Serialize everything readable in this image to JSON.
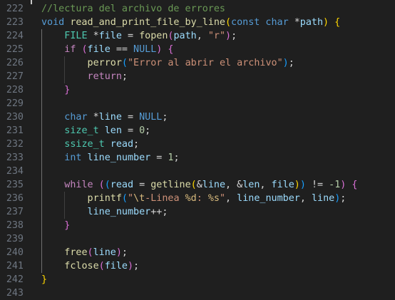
{
  "editor": {
    "language": "c",
    "colors": {
      "background": "#1f1f1f",
      "line_number": "#6e7681",
      "comment": "#6a9955",
      "keyword": "#569cd6",
      "control": "#c586c0",
      "type": "#4ec9b0",
      "function": "#dcdcaa",
      "variable": "#9cdcfe",
      "string": "#ce9178",
      "number": "#b5cea8",
      "bracket_1": "#ffd700",
      "bracket_2": "#da70d6",
      "bracket_3": "#179fff"
    },
    "lines": [
      {
        "num": "222",
        "indent": 0,
        "tokens": [
          {
            "t": "//lectura del archivo de errores",
            "c": "comment"
          }
        ]
      },
      {
        "num": "223",
        "indent": 0,
        "tokens": [
          {
            "t": "void",
            "c": "kw"
          },
          {
            "t": " ",
            "c": "op"
          },
          {
            "t": "read_and_print_file_by_line",
            "c": "fn"
          },
          {
            "t": "(",
            "c": "p1"
          },
          {
            "t": "const",
            "c": "kw"
          },
          {
            "t": " ",
            "c": "op"
          },
          {
            "t": "char",
            "c": "kw"
          },
          {
            "t": " *",
            "c": "op"
          },
          {
            "t": "path",
            "c": "var"
          },
          {
            "t": ")",
            "c": "p1"
          },
          {
            "t": " ",
            "c": "op"
          },
          {
            "t": "{",
            "c": "p1"
          }
        ]
      },
      {
        "num": "224",
        "indent": 1,
        "tokens": [
          {
            "t": "FILE",
            "c": "type"
          },
          {
            "t": " *",
            "c": "op"
          },
          {
            "t": "file",
            "c": "var"
          },
          {
            "t": " = ",
            "c": "op"
          },
          {
            "t": "fopen",
            "c": "fn"
          },
          {
            "t": "(",
            "c": "p2"
          },
          {
            "t": "path",
            "c": "var"
          },
          {
            "t": ", ",
            "c": "op"
          },
          {
            "t": "\"r\"",
            "c": "str"
          },
          {
            "t": ")",
            "c": "p2"
          },
          {
            "t": ";",
            "c": "op"
          }
        ]
      },
      {
        "num": "225",
        "indent": 1,
        "tokens": [
          {
            "t": "if",
            "c": "ctrl"
          },
          {
            "t": " ",
            "c": "op"
          },
          {
            "t": "(",
            "c": "p2"
          },
          {
            "t": "file",
            "c": "var"
          },
          {
            "t": " == ",
            "c": "op"
          },
          {
            "t": "NULL",
            "c": "kw"
          },
          {
            "t": ")",
            "c": "p2"
          },
          {
            "t": " ",
            "c": "op"
          },
          {
            "t": "{",
            "c": "p2"
          }
        ]
      },
      {
        "num": "226",
        "indent": 2,
        "tokens": [
          {
            "t": "perror",
            "c": "fn"
          },
          {
            "t": "(",
            "c": "p3"
          },
          {
            "t": "\"Error al abrir el archivo\"",
            "c": "str"
          },
          {
            "t": ")",
            "c": "p3"
          },
          {
            "t": ";",
            "c": "op"
          }
        ]
      },
      {
        "num": "227",
        "indent": 2,
        "tokens": [
          {
            "t": "return",
            "c": "ctrl"
          },
          {
            "t": ";",
            "c": "op"
          }
        ]
      },
      {
        "num": "228",
        "indent": 1,
        "tokens": [
          {
            "t": "}",
            "c": "p2"
          }
        ]
      },
      {
        "num": "229",
        "indent": 0,
        "tokens": []
      },
      {
        "num": "230",
        "indent": 1,
        "tokens": [
          {
            "t": "char",
            "c": "kw"
          },
          {
            "t": " *",
            "c": "op"
          },
          {
            "t": "line",
            "c": "var"
          },
          {
            "t": " = ",
            "c": "op"
          },
          {
            "t": "NULL",
            "c": "kw"
          },
          {
            "t": ";",
            "c": "op"
          }
        ]
      },
      {
        "num": "231",
        "indent": 1,
        "tokens": [
          {
            "t": "size_t",
            "c": "type"
          },
          {
            "t": " ",
            "c": "op"
          },
          {
            "t": "len",
            "c": "var"
          },
          {
            "t": " = ",
            "c": "op"
          },
          {
            "t": "0",
            "c": "num"
          },
          {
            "t": ";",
            "c": "op"
          }
        ]
      },
      {
        "num": "232",
        "indent": 1,
        "tokens": [
          {
            "t": "ssize_t",
            "c": "type"
          },
          {
            "t": " ",
            "c": "op"
          },
          {
            "t": "read",
            "c": "var"
          },
          {
            "t": ";",
            "c": "op"
          }
        ]
      },
      {
        "num": "233",
        "indent": 1,
        "tokens": [
          {
            "t": "int",
            "c": "kw"
          },
          {
            "t": " ",
            "c": "op"
          },
          {
            "t": "line_number",
            "c": "var"
          },
          {
            "t": " = ",
            "c": "op"
          },
          {
            "t": "1",
            "c": "num"
          },
          {
            "t": ";",
            "c": "op"
          }
        ]
      },
      {
        "num": "234",
        "indent": 0,
        "tokens": []
      },
      {
        "num": "235",
        "indent": 1,
        "tokens": [
          {
            "t": "while",
            "c": "ctrl"
          },
          {
            "t": " ",
            "c": "op"
          },
          {
            "t": "(",
            "c": "p2"
          },
          {
            "t": "(",
            "c": "p3"
          },
          {
            "t": "read",
            "c": "var"
          },
          {
            "t": " = ",
            "c": "op"
          },
          {
            "t": "getline",
            "c": "fn"
          },
          {
            "t": "(",
            "c": "p1"
          },
          {
            "t": "&",
            "c": "op"
          },
          {
            "t": "line",
            "c": "var"
          },
          {
            "t": ", &",
            "c": "op"
          },
          {
            "t": "len",
            "c": "var"
          },
          {
            "t": ", ",
            "c": "op"
          },
          {
            "t": "file",
            "c": "var"
          },
          {
            "t": ")",
            "c": "p1"
          },
          {
            "t": ")",
            "c": "p3"
          },
          {
            "t": " != ",
            "c": "op"
          },
          {
            "t": "-1",
            "c": "num"
          },
          {
            "t": ")",
            "c": "p2"
          },
          {
            "t": " ",
            "c": "op"
          },
          {
            "t": "{",
            "c": "p2"
          }
        ]
      },
      {
        "num": "236",
        "indent": 2,
        "tokens": [
          {
            "t": "printf",
            "c": "fn"
          },
          {
            "t": "(",
            "c": "p3"
          },
          {
            "t": "\"",
            "c": "str"
          },
          {
            "t": "\\t",
            "c": "esc"
          },
          {
            "t": "-Linea ",
            "c": "str"
          },
          {
            "t": "%d",
            "c": "esc"
          },
          {
            "t": ": ",
            "c": "str"
          },
          {
            "t": "%s",
            "c": "esc"
          },
          {
            "t": "\"",
            "c": "str"
          },
          {
            "t": ", ",
            "c": "op"
          },
          {
            "t": "line_number",
            "c": "var"
          },
          {
            "t": ", ",
            "c": "op"
          },
          {
            "t": "line",
            "c": "var"
          },
          {
            "t": ")",
            "c": "p3"
          },
          {
            "t": ";",
            "c": "op"
          }
        ]
      },
      {
        "num": "237",
        "indent": 2,
        "tokens": [
          {
            "t": "line_number",
            "c": "var"
          },
          {
            "t": "++;",
            "c": "op"
          }
        ]
      },
      {
        "num": "238",
        "indent": 1,
        "tokens": [
          {
            "t": "}",
            "c": "p2"
          }
        ]
      },
      {
        "num": "239",
        "indent": 0,
        "tokens": []
      },
      {
        "num": "240",
        "indent": 1,
        "tokens": [
          {
            "t": "free",
            "c": "fn"
          },
          {
            "t": "(",
            "c": "p2"
          },
          {
            "t": "line",
            "c": "var"
          },
          {
            "t": ")",
            "c": "p2"
          },
          {
            "t": ";",
            "c": "op"
          }
        ]
      },
      {
        "num": "241",
        "indent": 1,
        "tokens": [
          {
            "t": "fclose",
            "c": "fn"
          },
          {
            "t": "(",
            "c": "p2"
          },
          {
            "t": "file",
            "c": "var"
          },
          {
            "t": ")",
            "c": "p2"
          },
          {
            "t": ";",
            "c": "op"
          }
        ]
      },
      {
        "num": "242",
        "indent": 0,
        "tokens": [
          {
            "t": "}",
            "c": "p1"
          }
        ]
      },
      {
        "num": "243",
        "indent": 0,
        "tokens": []
      }
    ]
  }
}
